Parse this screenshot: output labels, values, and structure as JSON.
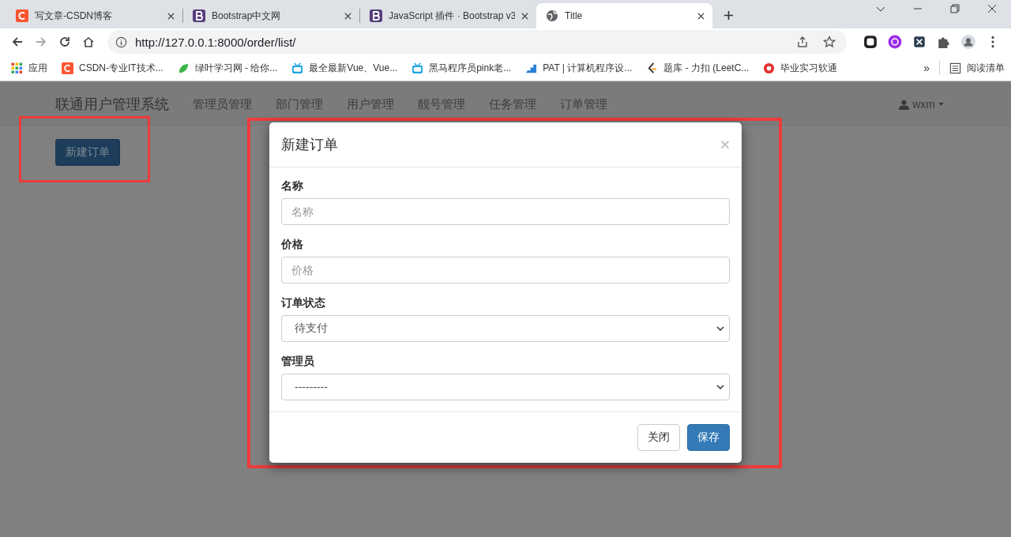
{
  "browser": {
    "tabs": [
      {
        "title": "写文章-CSDN博客",
        "kind": "csdn",
        "selected": false
      },
      {
        "title": "Bootstrap中文网",
        "kind": "bootstrap",
        "selected": false
      },
      {
        "title": "JavaScript 插件 · Bootstrap v3",
        "kind": "bootstrap",
        "selected": false
      },
      {
        "title": "Title",
        "kind": "globe",
        "selected": true
      }
    ],
    "address": "http://127.0.0.1:8000/order/list/",
    "bookmarks": [
      {
        "label": "应用",
        "kind": "apps"
      },
      {
        "label": "CSDN-专业IT技术...",
        "kind": "csdn"
      },
      {
        "label": "绿叶学习网 - 给你...",
        "kind": "leaf"
      },
      {
        "label": "最全最新Vue、Vue...",
        "kind": "tv"
      },
      {
        "label": "黑马程序员pink老...",
        "kind": "tv"
      },
      {
        "label": "PAT | 计算机程序设...",
        "kind": "pat"
      },
      {
        "label": "题库 - 力扣 (LeetC...",
        "kind": "leetcode"
      },
      {
        "label": "毕业实习软通",
        "kind": "red"
      }
    ],
    "more": "»",
    "reading_list": "阅读清单"
  },
  "navbar": {
    "brand": "联通用户管理系统",
    "items": [
      "管理员管理",
      "部门管理",
      "用户管理",
      "靓号管理",
      "任务管理",
      "订单管理"
    ],
    "user": "wxm"
  },
  "page": {
    "new_button": "新建订单"
  },
  "modal": {
    "title": "新建订单",
    "close": "×",
    "fields": [
      {
        "label": "名称",
        "kind": "input",
        "placeholder": "名称"
      },
      {
        "label": "价格",
        "kind": "input",
        "placeholder": "价格"
      },
      {
        "label": "订单状态",
        "kind": "select",
        "value": "待支付"
      },
      {
        "label": "管理员",
        "kind": "select",
        "value": "---------"
      }
    ],
    "buttons": [
      {
        "label": "关闭",
        "kind": "default"
      },
      {
        "label": "保存",
        "kind": "primary"
      }
    ]
  },
  "annotations": [
    {
      "kind": "rectangle"
    },
    {
      "kind": "rectangle"
    }
  ]
}
